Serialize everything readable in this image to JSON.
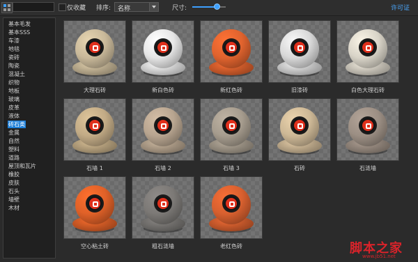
{
  "toolbar": {
    "search_value": "",
    "favorites_label": "仅收藏",
    "sort_label": "排序:",
    "sort_value": "名称",
    "size_label": "尺寸:",
    "size_level": 0.75,
    "license_label": "许可证",
    "accent_color": "#3da0ff"
  },
  "sidebar": {
    "items": [
      {
        "label": "基本毛发"
      },
      {
        "label": "基本SSS"
      },
      {
        "label": "车漆"
      },
      {
        "label": "地毯"
      },
      {
        "label": "瓷砖"
      },
      {
        "label": "陶瓷"
      },
      {
        "label": "混凝土"
      },
      {
        "label": "织物"
      },
      {
        "label": "地板"
      },
      {
        "label": "玻璃"
      },
      {
        "label": "皮革"
      },
      {
        "label": "液体"
      },
      {
        "label": "砖石类",
        "active": true
      },
      {
        "label": "金属"
      },
      {
        "label": "自然"
      },
      {
        "label": "塑料"
      },
      {
        "label": "道路"
      },
      {
        "label": "屋顶和瓦片"
      },
      {
        "label": "橡胶"
      },
      {
        "label": "皮肤"
      },
      {
        "label": "石头"
      },
      {
        "label": "墙壁"
      },
      {
        "label": "木材"
      }
    ]
  },
  "materials": [
    {
      "label": "大理石砖",
      "color": "#c9b99a"
    },
    {
      "label": "新白色砖",
      "color": "#e6e6e6"
    },
    {
      "label": "新红色砖",
      "color": "#e0632e"
    },
    {
      "label": "旧漆砖",
      "color": "#d8d8d8"
    },
    {
      "label": "白色大理石砖",
      "color": "#d9d4c8"
    },
    {
      "label": "石墙 1",
      "color": "#c2ab86"
    },
    {
      "label": "石墙 2",
      "color": "#b8a590"
    },
    {
      "label": "石墙 3",
      "color": "#a69c8e"
    },
    {
      "label": "石砖",
      "color": "#cdb896"
    },
    {
      "label": "石涟墙",
      "color": "#9c8f84"
    },
    {
      "label": "空心粘土砖",
      "color": "#e06128"
    },
    {
      "label": "粗石涟墙",
      "color": "#7c7976"
    },
    {
      "label": "老红色砖",
      "color": "#d8602f"
    }
  ],
  "watermark": {
    "text": "脚本之家",
    "url": "www.jb51.net",
    "color": "#d8232a"
  }
}
